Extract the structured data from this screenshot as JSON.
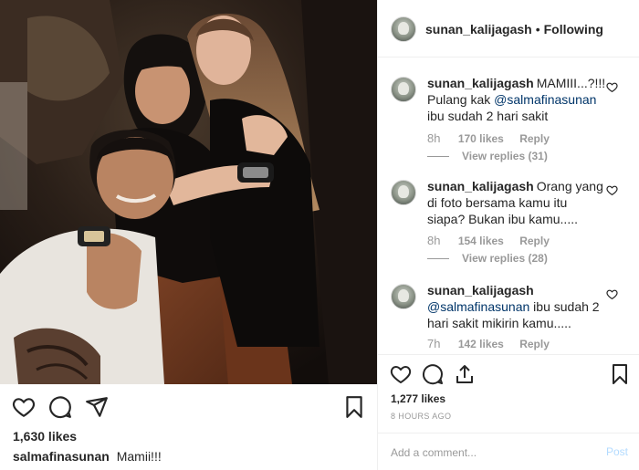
{
  "post": {
    "username": "salmafinasunan",
    "caption": "Mamii!!!",
    "likes_left": "1,630 likes",
    "photo_icons": [
      "heart-icon",
      "comment-icon",
      "share-icon",
      "bookmark-icon"
    ]
  },
  "panel": {
    "header": {
      "username": "sunan_kalijagash",
      "separator": "•",
      "follow_label": "Following"
    },
    "comments": [
      {
        "user": "sunan_kalijagash",
        "text_before": "MAMIII...?!!!\nPulang kak ",
        "mention": "@salmafinasunan",
        "text_after": " ibu sudah 2 hari sakit",
        "time": "8h",
        "likes": "170 likes",
        "reply": "Reply",
        "view_replies": "View replies (31)"
      },
      {
        "user": "sunan_kalijagash",
        "text_before": "Orang yang di foto bersama kamu itu siapa? Bukan ibu kamu.....",
        "mention": "",
        "text_after": "",
        "time": "8h",
        "likes": "154 likes",
        "reply": "Reply",
        "view_replies": "View replies (28)"
      },
      {
        "user": "sunan_kalijagash",
        "text_before": "",
        "mention": "@salmafinasunan",
        "text_after": " ibu sudah 2 hari sakit mikirin kamu.....",
        "time": "7h",
        "likes": "142 likes",
        "reply": "Reply",
        "view_replies": ""
      }
    ],
    "likes": "1,277 likes",
    "date": "8 HOURS AGO",
    "add_comment_placeholder": "Add a comment...",
    "post_label": "Post"
  },
  "colors": {
    "mention": "#003569",
    "meta": "#999999",
    "post_disabled": "#b3dbff",
    "border": "#efefef"
  }
}
